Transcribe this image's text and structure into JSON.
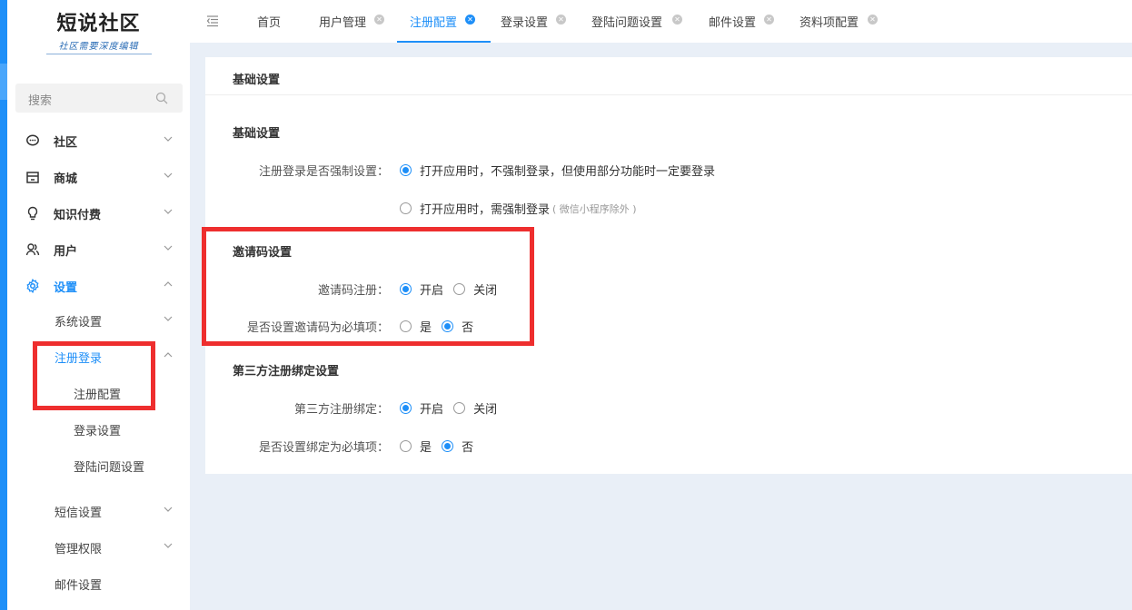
{
  "brand": {
    "name": "短说社区",
    "slogan": "社区需要深度编辑"
  },
  "search": {
    "placeholder": "搜索"
  },
  "sidebar": {
    "items": [
      {
        "label": "社区",
        "icon": "chat-icon"
      },
      {
        "label": "商城",
        "icon": "store-icon"
      },
      {
        "label": "知识付费",
        "icon": "bulb-icon"
      },
      {
        "label": "用户",
        "icon": "users-icon"
      },
      {
        "label": "设置",
        "icon": "gear-icon"
      }
    ],
    "settings_children": [
      {
        "label": "系统设置"
      },
      {
        "label": "注册登录"
      }
    ],
    "register_children": [
      {
        "label": "注册配置"
      },
      {
        "label": "登录设置"
      },
      {
        "label": "登陆问题设置"
      }
    ],
    "more": [
      {
        "label": "短信设置"
      },
      {
        "label": "管理权限"
      },
      {
        "label": "邮件设置"
      }
    ]
  },
  "tabs": [
    {
      "label": "首页"
    },
    {
      "label": "用户管理"
    },
    {
      "label": "注册配置"
    },
    {
      "label": "登录设置"
    },
    {
      "label": "登陆问题设置"
    },
    {
      "label": "邮件设置"
    },
    {
      "label": "资料项配置"
    }
  ],
  "panel": {
    "title": "基础设置",
    "basic": {
      "heading": "基础设置",
      "force_label": "注册登录是否强制设置：",
      "opt1": "打开应用时，不强制登录，但使用部分功能时一定要登录",
      "opt2": "打开应用时，需强制登录",
      "opt2_hint": "( 微信小程序除外 )"
    },
    "invite": {
      "heading": "邀请码设置",
      "reg_label": "邀请码注册：",
      "required_label": "是否设置邀请码为必填项："
    },
    "third": {
      "heading": "第三方注册绑定设置",
      "bind_label": "第三方注册绑定：",
      "required_label": "是否设置绑定为必填项："
    },
    "options": {
      "on": "开启",
      "off": "关闭",
      "yes": "是",
      "no": "否"
    }
  },
  "colors": {
    "accent": "#1e8ff8",
    "highlight": "#ee2e2e"
  }
}
